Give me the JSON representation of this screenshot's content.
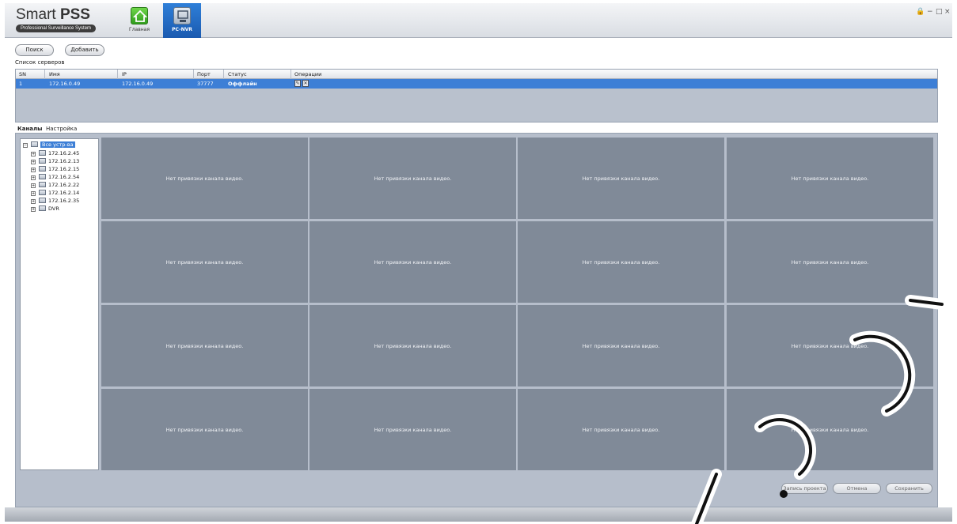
{
  "app": {
    "title_light": "Smart ",
    "title_bold": "PSS",
    "subtitle": "Professional Surveillance System"
  },
  "nav": {
    "home_label": "Главная",
    "nvr_label": "PC-NVR"
  },
  "window_controls": {
    "lock": "🔒",
    "minimize": "−",
    "maximize": "□",
    "close": "×"
  },
  "toolbar": {
    "search_label": "Поиск",
    "add_label": "Добавить"
  },
  "server_list": {
    "caption": "Список серверов",
    "columns": [
      "SN",
      "Имя",
      "IP",
      "Порт",
      "Статус",
      "Операции"
    ],
    "rows": [
      {
        "sn": "1",
        "name": "172.16.0.49",
        "ip": "172.16.0.49",
        "port": "37777",
        "status": "Оффлайн"
      }
    ]
  },
  "tabs": {
    "channels": "Каналы",
    "settings": "Настройка"
  },
  "tree": {
    "root": "Все устр-ва",
    "devices": [
      "172.16.2.45",
      "172.16.2.13",
      "172.16.2.15",
      "172.16.2.54",
      "172.16.2.22",
      "172.16.2.14",
      "172.16.2.35",
      "DVR"
    ]
  },
  "grid": {
    "cell_text": "Нет привязки канала видео.",
    "rows": 4,
    "cols": 4
  },
  "actions": {
    "record": "Запись проекта",
    "cancel": "Отмена",
    "save": "Сохранить"
  },
  "colors": {
    "accent": "#3d7fd6",
    "cell_bg": "#808a98",
    "panel_bg": "#b6becb"
  }
}
